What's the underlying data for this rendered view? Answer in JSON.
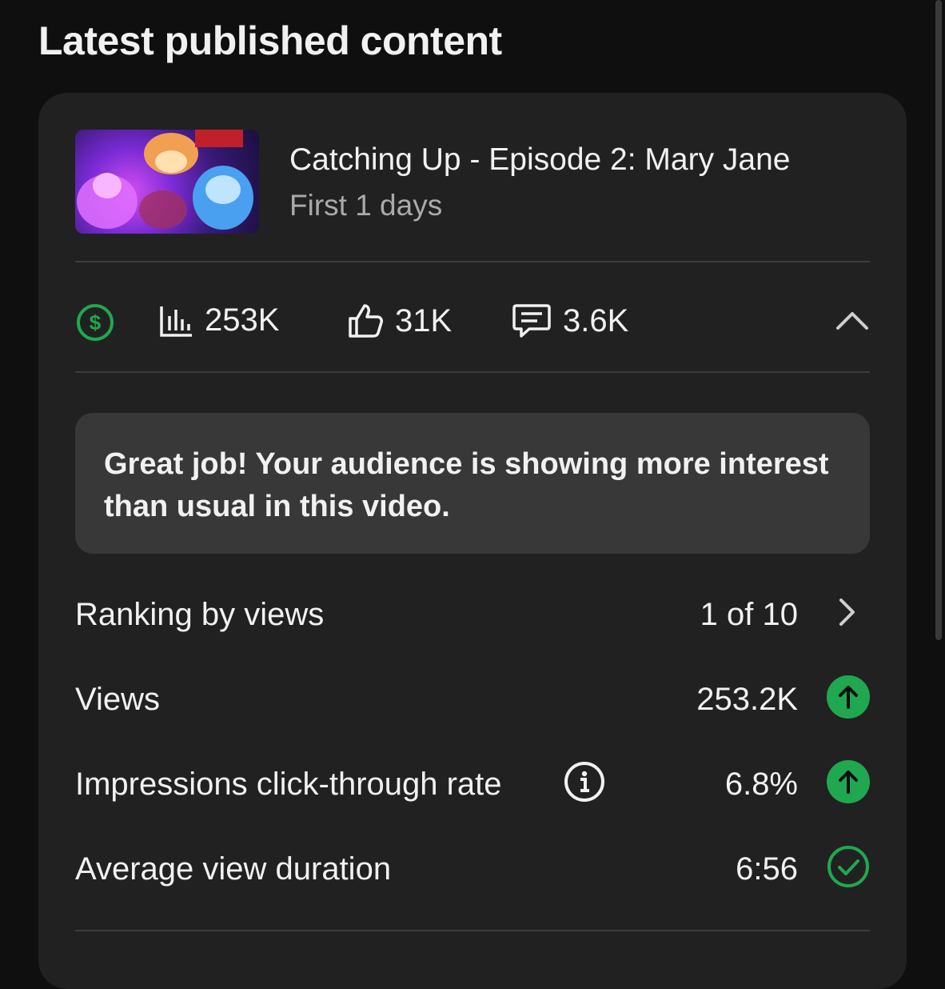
{
  "section": {
    "title": "Latest published content"
  },
  "video": {
    "title": "Catching Up - Episode 2: Mary Jane",
    "subtitle": "First 1 days"
  },
  "stats": {
    "monetization_icon": "dollar-circle-icon",
    "views": "253K",
    "likes": "31K",
    "comments": "3.6K"
  },
  "banner": {
    "text": "Great job! Your audience is showing more interest than usual in this video."
  },
  "metrics": [
    {
      "label": "Ranking by views",
      "value": "1 of 10",
      "icon": "chevron-right-icon"
    },
    {
      "label": "Views",
      "value": "253.2K",
      "icon": "arrow-up-circle-icon"
    },
    {
      "label": "Impressions click-through rate",
      "value": "6.8%",
      "icon": "arrow-up-circle-icon"
    },
    {
      "label": "Average view duration",
      "value": "6:56",
      "icon": "check-circle-icon"
    }
  ],
  "colors": {
    "accent_green": "#1fa84f",
    "background": "#0f0f0f",
    "card": "#212121",
    "banner": "#383838"
  }
}
